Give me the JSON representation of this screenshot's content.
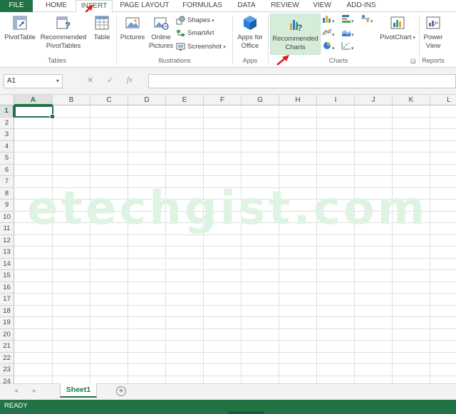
{
  "ribbon_tabs": [
    {
      "label": "FILE"
    },
    {
      "label": "HOME"
    },
    {
      "label": "INSERT"
    },
    {
      "label": "PAGE LAYOUT"
    },
    {
      "label": "FORMULAS"
    },
    {
      "label": "DATA"
    },
    {
      "label": "REVIEW"
    },
    {
      "label": "VIEW"
    },
    {
      "label": "ADD-INS"
    }
  ],
  "active_tab": "INSERT",
  "groups": {
    "tables": {
      "label": "Tables",
      "pivot_table": "PivotTable",
      "recommended_pivot_line1": "Recommended",
      "recommended_pivot_line2": "PivotTables",
      "table": "Table"
    },
    "illustrations": {
      "label": "Illustrations",
      "pictures": "Pictures",
      "online_pictures_line1": "Online",
      "online_pictures_line2": "Pictures",
      "shapes": "Shapes",
      "smartart": "SmartArt",
      "screenshot": "Screenshot"
    },
    "apps": {
      "label": "Apps",
      "apps_line1": "Apps for",
      "apps_line2": "Office"
    },
    "charts": {
      "label": "Charts",
      "recommended_line1": "Recommended",
      "recommended_line2": "Charts",
      "pivot_chart": "PivotChart"
    },
    "reports": {
      "label": "Reports",
      "power_view_line1": "Power",
      "power_view_line2": "View"
    }
  },
  "formula_bar": {
    "name_box": "A1",
    "cancel": "✕",
    "enter": "✓",
    "fx": "fx",
    "value": ""
  },
  "columns": [
    "A",
    "B",
    "C",
    "D",
    "E",
    "F",
    "G",
    "H",
    "I",
    "J",
    "K",
    "L"
  ],
  "rows": [
    "1",
    "2",
    "3",
    "4",
    "5",
    "6",
    "7",
    "8",
    "9",
    "10",
    "11",
    "12",
    "13",
    "14",
    "15",
    "16",
    "17",
    "18",
    "19",
    "20",
    "21",
    "22",
    "23",
    "24"
  ],
  "selected_cell": "A1",
  "watermark": "etechgist.com",
  "sheets": [
    {
      "name": "Sheet1",
      "active": true
    }
  ],
  "status": "READY",
  "colors": {
    "excel_green": "#217346",
    "highlight": "#d5ecd9",
    "arrow_red": "#e21b1b"
  }
}
